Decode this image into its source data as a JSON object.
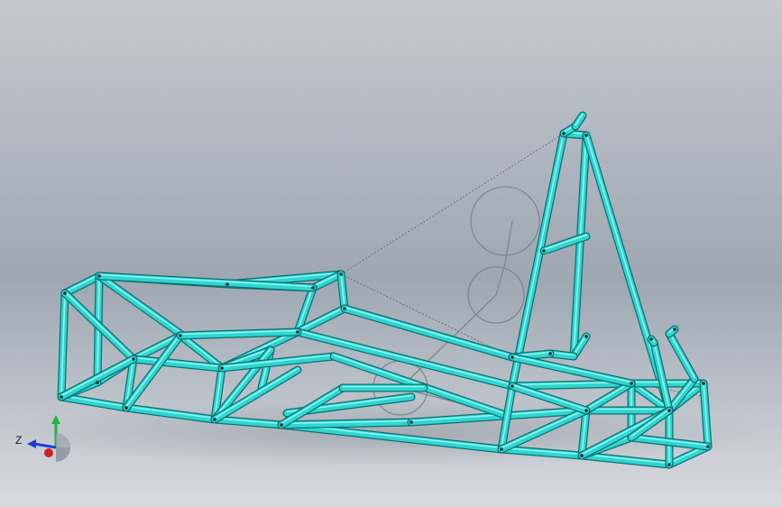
{
  "viewport": {
    "background_top": "#c8ccd2",
    "background_bottom": "#d6d9df",
    "tube_color": "#2fd6d0"
  },
  "triad": {
    "label_z": "Z",
    "y_axis_color": "#22b43c",
    "z_axis_color": "#1f3fd2",
    "x_axis_color": "#d22222"
  }
}
